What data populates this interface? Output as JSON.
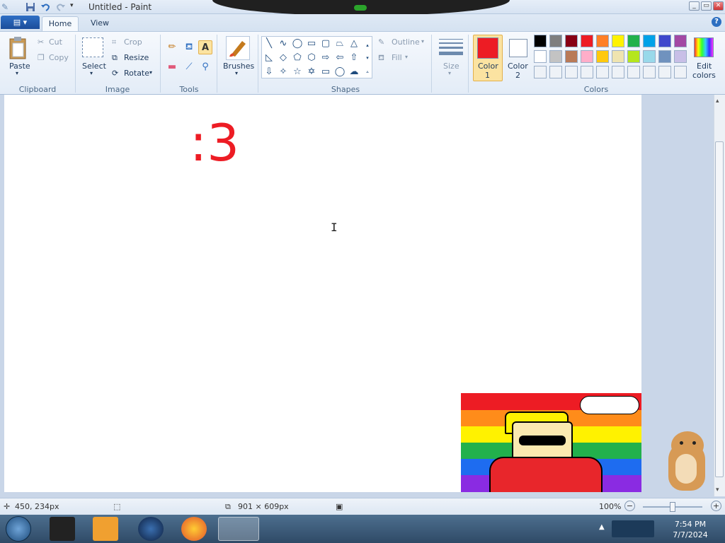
{
  "window": {
    "title": "Untitled - Paint",
    "min": "_",
    "max": "▭",
    "close": "✕"
  },
  "menu": {
    "file": "▤ ▾",
    "tabs": [
      "Home",
      "View"
    ],
    "help": "?"
  },
  "ribbon": {
    "clipboard": {
      "paste": "Paste",
      "cut": "Cut",
      "copy": "Copy",
      "group": "Clipboard"
    },
    "image": {
      "select": "Select",
      "crop": "Crop",
      "resize": "Resize",
      "rotate": "Rotate",
      "group": "Image"
    },
    "tools": {
      "group": "Tools"
    },
    "brushes": {
      "label": "Brushes"
    },
    "shapes": {
      "outline": "Outline",
      "fill": "Fill",
      "group": "Shapes"
    },
    "size": {
      "label": "Size"
    },
    "colors": {
      "color1_a": "Color",
      "color1_b": "1",
      "color2_a": "Color",
      "color2_b": "2",
      "edit_a": "Edit",
      "edit_b": "colors",
      "group": "Colors",
      "color1": "#ed1c24",
      "color2": "#ffffff",
      "row1": [
        "#000000",
        "#7f7f7f",
        "#880015",
        "#ed1c24",
        "#ff7f27",
        "#fff200",
        "#22b14c",
        "#00a2e8",
        "#3f48cc",
        "#a349a4"
      ],
      "row2": [
        "#ffffff",
        "#c3c3c3",
        "#b97a57",
        "#ffaec9",
        "#ffc90e",
        "#efe4b0",
        "#b5e61d",
        "#99d9ea",
        "#7092be",
        "#c8bfe7"
      ]
    }
  },
  "canvas": {
    "text": ":3",
    "text_color": "#ed1c24"
  },
  "status": {
    "cursor_pos": "450, 234px",
    "canvas_size": "901 × 609px",
    "zoom": "100%"
  },
  "taskbar": {
    "time": "7:54 PM",
    "date": "7/7/2024"
  }
}
